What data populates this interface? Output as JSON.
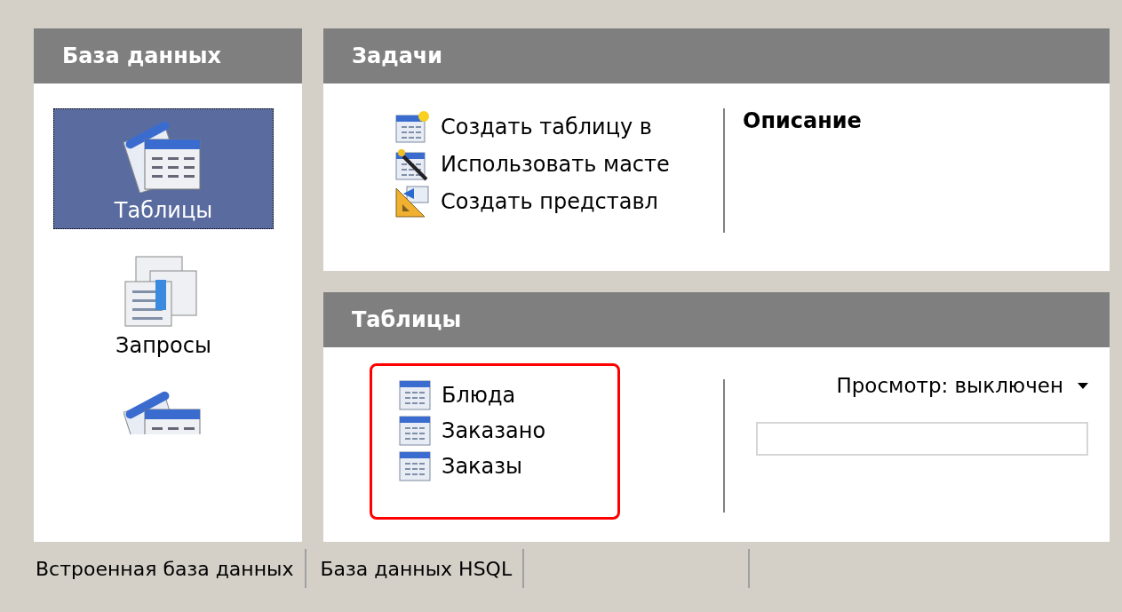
{
  "sidebar": {
    "title": "База данных",
    "items": [
      {
        "kind": "table",
        "label": "Таблицы",
        "selected": true
      },
      {
        "kind": "query",
        "label": "Запросы",
        "selected": false
      },
      {
        "kind": "form",
        "selected": false
      }
    ]
  },
  "tasks": {
    "title": "Задачи",
    "items": [
      {
        "kind": "new-table",
        "label": "Создать таблицу в"
      },
      {
        "kind": "wizard",
        "label": "Использовать масте"
      },
      {
        "kind": "view",
        "label": "Создать представл"
      }
    ],
    "description_title": "Описание"
  },
  "tables": {
    "title": "Таблицы",
    "highlighted": true,
    "items": [
      {
        "label": "Блюда"
      },
      {
        "label": "Заказано"
      },
      {
        "label": "Заказы"
      }
    ],
    "preview": {
      "label": "Просмотр: выключен"
    }
  },
  "status_bar": [
    "Встроенная база данных",
    "База данных HSQL"
  ]
}
